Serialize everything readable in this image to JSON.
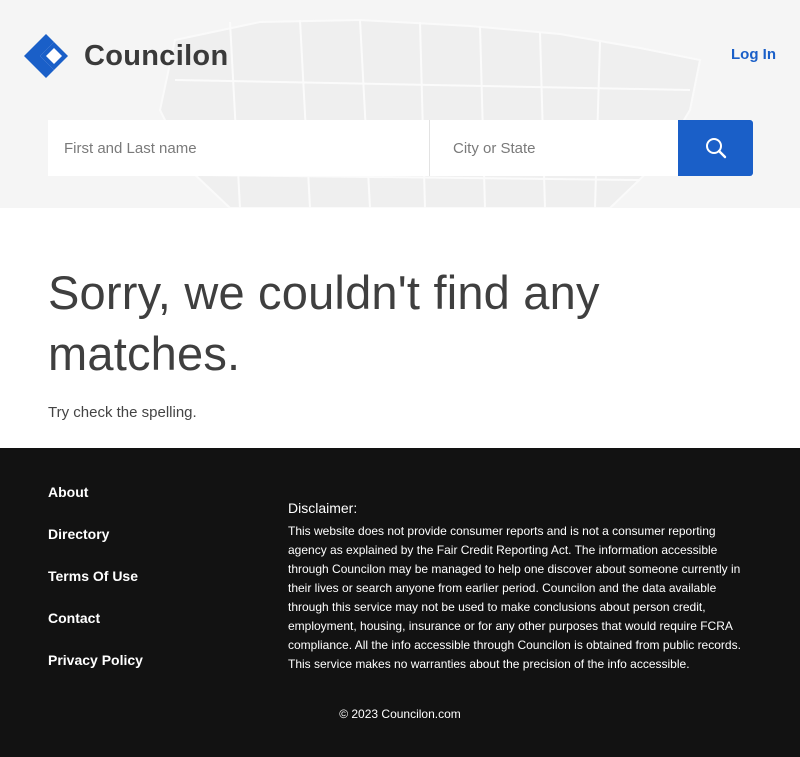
{
  "header": {
    "brand": "Councilon",
    "login_label": "Log In",
    "logo_icon": "diamond-logo-icon",
    "colors": {
      "accent": "#1a5fc8",
      "background": "#f5f5f5"
    }
  },
  "search": {
    "name_placeholder": "First and Last name",
    "name_value": "",
    "location_placeholder": "City or State",
    "location_value": "",
    "button_icon": "search-icon"
  },
  "main": {
    "heading": "Sorry, we couldn't find any matches.",
    "subtext": "Try check the spelling."
  },
  "footer": {
    "links": [
      "About",
      "Directory",
      "Terms Of Use",
      "Contact",
      "Privacy Policy"
    ],
    "disclaimer_title": "Disclaimer:",
    "disclaimer_text": "This website does not provide consumer reports and is not a consumer reporting agency as explained by the Fair Credit Reporting Act. The information accessible through Councilon may be managed to help one discover about someone currently in their lives or search anyone from earlier period. Councilon and the data available through this service may not be used to make conclusions about person credit, employment, housing, insurance or for any other purposes that would require FCRA compliance. All the info accessible through Councilon is obtained from public records. This service makes no warranties about the precision of the info accessible.",
    "copyright": "© 2023 Councilon.com",
    "colors": {
      "background": "#121212"
    }
  }
}
